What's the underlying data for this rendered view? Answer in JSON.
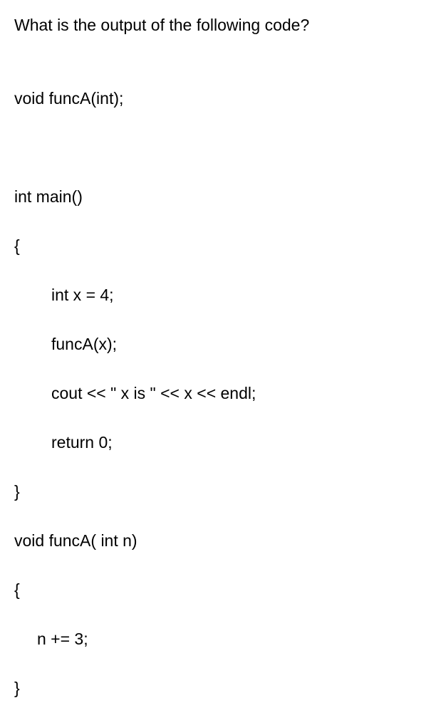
{
  "question": "What is the output of the following code?",
  "code": {
    "line1": "void funcA(int);",
    "line2": "int main()",
    "line3": "{",
    "line4": "int x = 4;",
    "line5": "funcA(x);",
    "line6": "cout << \" x is \" << x << endl;",
    "line7": "return 0;",
    "line8": "}",
    "line9": "void funcA( int n)",
    "line10": "{",
    "line11": "n += 3;",
    "line12": "}"
  }
}
